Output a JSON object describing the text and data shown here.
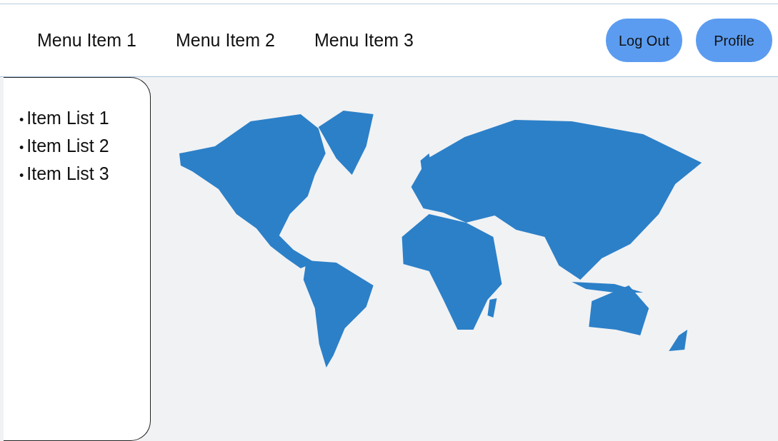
{
  "menu": [
    {
      "label": "Menu Item 1"
    },
    {
      "label": "Menu Item 2"
    },
    {
      "label": "Menu Item 3"
    }
  ],
  "buttons": [
    {
      "label": "Log Out"
    },
    {
      "label": "Profile"
    }
  ],
  "sidebar": {
    "items": [
      {
        "marker": "•",
        "label": "Item List 1"
      },
      {
        "marker": "•",
        "label": "Item List 2"
      },
      {
        "marker": "•",
        "label": "Item List 3"
      }
    ]
  },
  "main": {
    "kind": "map"
  }
}
